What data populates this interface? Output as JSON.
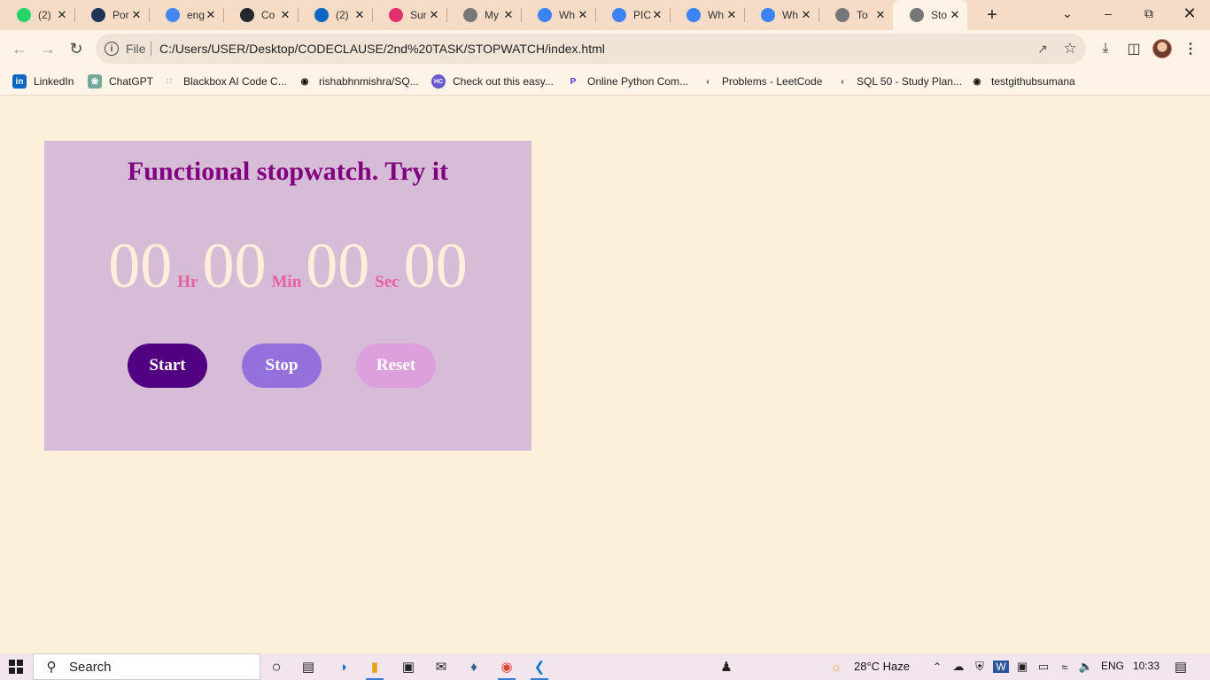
{
  "browser": {
    "tabs": [
      {
        "title": "(2)",
        "icon": "whatsapp-icon",
        "color": "#25d366"
      },
      {
        "title": "Por",
        "icon": "portfolio-icon",
        "color": "#1d3557"
      },
      {
        "title": "eng",
        "icon": "google-icon",
        "color": "#4285f4"
      },
      {
        "title": "Co",
        "icon": "github-icon",
        "color": "#24292e"
      },
      {
        "title": "(2)",
        "icon": "linkedin-icon",
        "color": "#0a66c2"
      },
      {
        "title": "Sur",
        "icon": "instagram-icon",
        "color": "#e1306c"
      },
      {
        "title": "My",
        "icon": "globe-icon",
        "color": "#777777"
      },
      {
        "title": "Wh",
        "icon": "pw-icon",
        "color": "#3b82f6"
      },
      {
        "title": "PIC",
        "icon": "pw-icon",
        "color": "#3b82f6"
      },
      {
        "title": "Wh",
        "icon": "pw-icon",
        "color": "#3b82f6"
      },
      {
        "title": "Wh",
        "icon": "pw-icon",
        "color": "#3b82f6"
      },
      {
        "title": "To",
        "icon": "globe-icon",
        "color": "#777777"
      },
      {
        "title": "Sto",
        "icon": "globe-icon",
        "color": "#777777"
      }
    ],
    "active_tab": 12,
    "url_scheme": "File",
    "url": "C:/Users/USER/Desktop/CODECLAUSE/2nd%20TASK/STOPWATCH/index.html",
    "bookmarks": [
      {
        "label": "LinkedIn",
        "icon": "linkedin-icon"
      },
      {
        "label": "ChatGPT",
        "icon": "chatgpt-icon"
      },
      {
        "label": "Blackbox AI Code C...",
        "icon": "blackbox-icon"
      },
      {
        "label": "rishabhnmishra/SQ...",
        "icon": "github-icon"
      },
      {
        "label": "Check out this easy...",
        "icon": "hc-icon"
      },
      {
        "label": "Online Python Com...",
        "icon": "programiz-icon"
      },
      {
        "label": "Problems - LeetCode",
        "icon": "leetcode-icon"
      },
      {
        "label": "SQL 50 - Study Plan...",
        "icon": "leetcode-icon"
      },
      {
        "label": "testgithubsumana",
        "icon": "github-icon"
      }
    ]
  },
  "stopwatch": {
    "title": "Functional stopwatch. Try it",
    "hours": "00",
    "hours_unit": "Hr",
    "minutes": "00",
    "minutes_unit": "Min",
    "seconds": "00",
    "seconds_unit": "Sec",
    "centiseconds": "00",
    "buttons": {
      "start": "Start",
      "stop": "Stop",
      "reset": "Reset"
    },
    "colors": {
      "card": "#d7bcd7",
      "title": "#800080",
      "digits": "#fdefd9",
      "units": "#e8609e",
      "start": "#500080",
      "stop": "#9370db",
      "reset": "#dda0dd"
    }
  },
  "taskbar": {
    "search_placeholder": "Search",
    "weather": "28°C  Haze",
    "language": "ENG",
    "time": "10:33"
  }
}
